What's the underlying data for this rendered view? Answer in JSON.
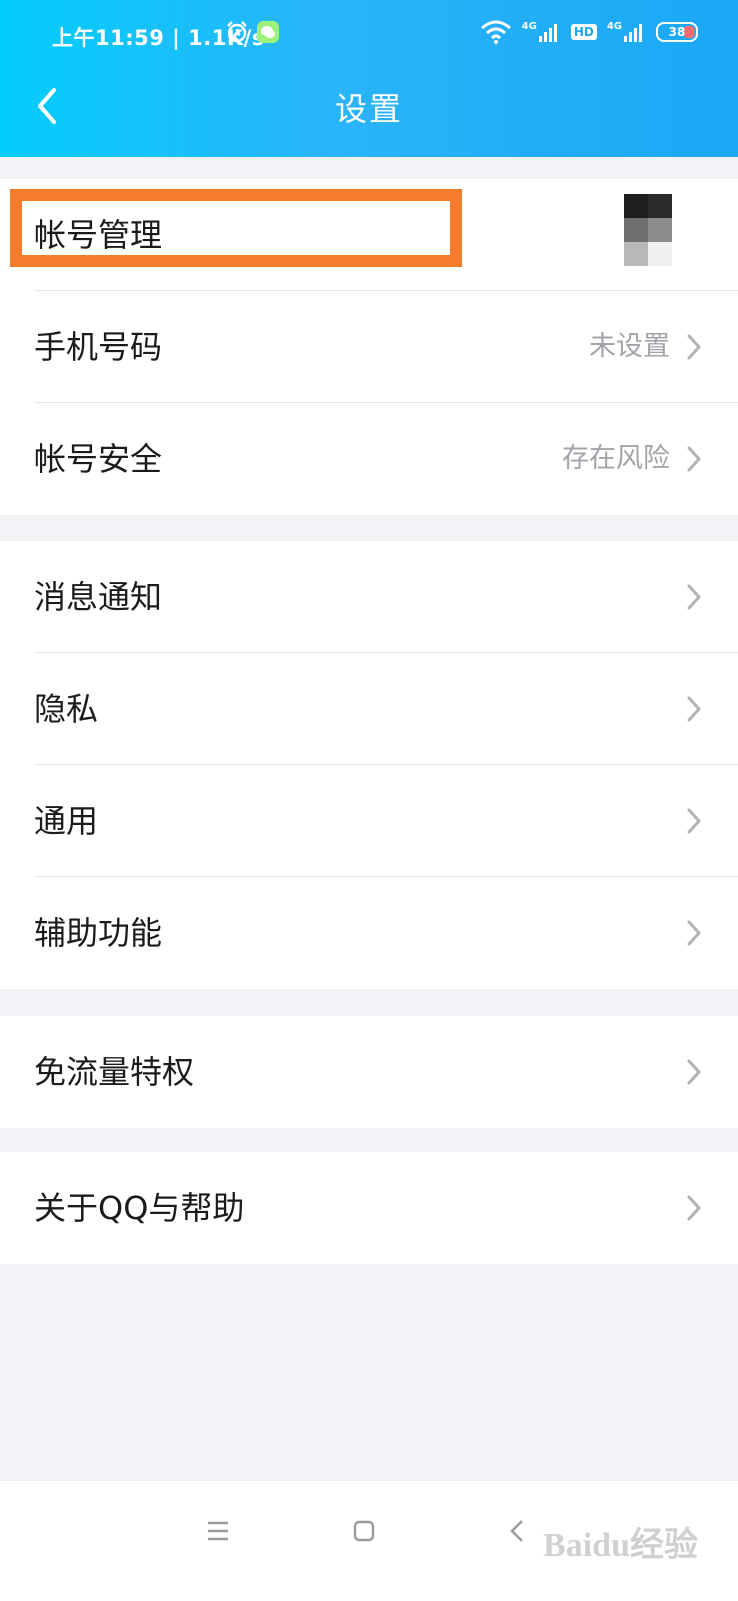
{
  "status_bar": {
    "time": "上午11:59",
    "net_speed": "1.1K/s",
    "battery": "38",
    "signal_1": "4G",
    "signal_2": "4G",
    "hd": "HD",
    "icons": [
      "alarm-icon",
      "wechat-icon",
      "wifi-icon",
      "signal-icon",
      "battery-icon"
    ]
  },
  "header": {
    "title": "设置",
    "back_icon": "chevron-left-icon"
  },
  "groups": [
    {
      "items": [
        {
          "label": "帐号管理",
          "value": "",
          "highlighted": true
        },
        {
          "label": "手机号码",
          "value": "未设置"
        },
        {
          "label": "帐号安全",
          "value": "存在风险"
        }
      ]
    },
    {
      "items": [
        {
          "label": "消息通知",
          "value": ""
        },
        {
          "label": "隐私",
          "value": ""
        },
        {
          "label": "通用",
          "value": ""
        },
        {
          "label": "辅助功能",
          "value": ""
        }
      ]
    },
    {
      "items": [
        {
          "label": "免流量特权",
          "value": ""
        }
      ]
    },
    {
      "items": [
        {
          "label": "关于QQ与帮助",
          "value": ""
        }
      ]
    }
  ],
  "nav": {
    "watermark": "Baidu经验",
    "buttons": [
      "menu-icon",
      "home-icon",
      "back-icon"
    ]
  },
  "colors": {
    "header_start": "#04cdfb",
    "header_end": "#1aa8f5",
    "highlight": "#f57c2a",
    "secondary_text": "#a2a4a9",
    "page_bg": "#f2f3f7"
  }
}
